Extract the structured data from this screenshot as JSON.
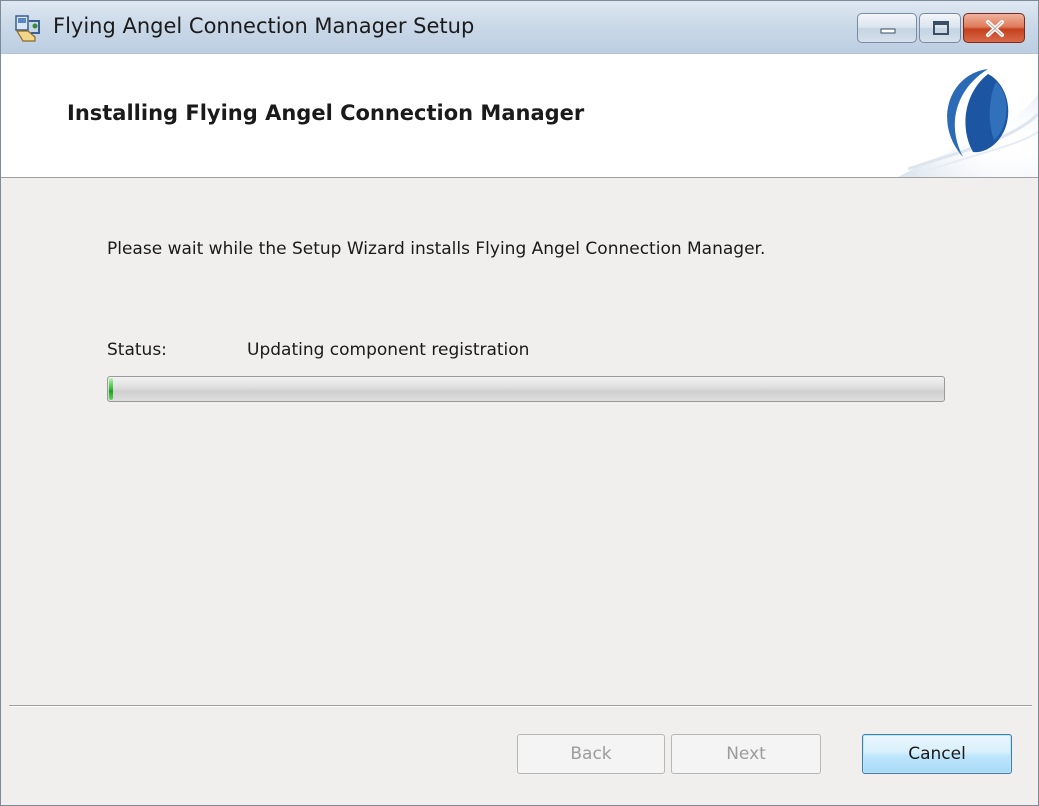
{
  "window": {
    "title": "Flying Angel Connection Manager Setup"
  },
  "banner": {
    "title": "Installing Flying Angel Connection Manager",
    "logo_icon": "crescent-logo-icon"
  },
  "body": {
    "intro": "Please wait while the Setup Wizard installs Flying Angel Connection Manager.",
    "status_label": "Status:",
    "status_value": "Updating component registration",
    "progress_fraction": 0.005
  },
  "buttons": {
    "back": "Back",
    "next": "Next",
    "cancel": "Cancel"
  },
  "colors": {
    "accent": "#1f5fa8",
    "progress_green": "#2db52d"
  }
}
